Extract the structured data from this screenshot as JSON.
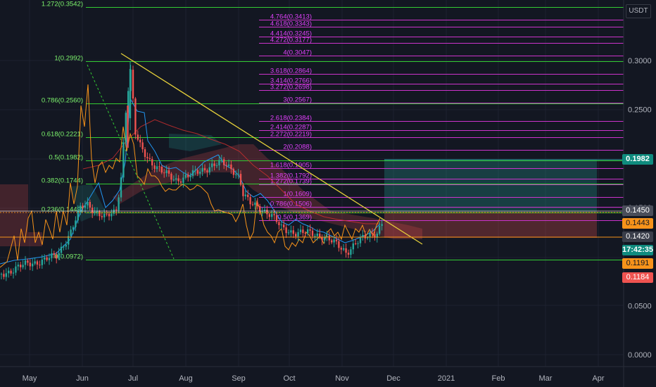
{
  "chart_data": {
    "type": "candlestick",
    "symbol_currency": "USDT",
    "xaxis": {
      "months": [
        "May",
        "Jun",
        "Jul",
        "Aug",
        "Sep",
        "Oct",
        "Nov",
        "Dec",
        "2021",
        "Feb",
        "Mar",
        "Apr"
      ]
    },
    "yaxis": {
      "ticks": [
        "0.3000",
        "0.2500",
        "0.1500",
        "0.0500",
        "0.0000"
      ],
      "scale": "linear"
    },
    "price_tags": [
      {
        "value": "0.1982",
        "color": "#0f8b7e"
      },
      {
        "value": "0.1450",
        "color": "#4a4e5a"
      },
      {
        "value": "0.1443",
        "color": "#f7931a"
      },
      {
        "value": "0.1420",
        "color": "#3a3e4a"
      },
      {
        "value": "17:42:35",
        "color": "#0f8b7e"
      },
      {
        "value": "0.1191",
        "color": "#f7931a"
      },
      {
        "value": "0.1184",
        "color": "#ef5350"
      }
    ],
    "fib_retracement": [
      {
        "level": "1.272(0.3542)",
        "price": 0.3542
      },
      {
        "level": "1(0.2992)",
        "price": 0.2992
      },
      {
        "level": "0.786(0.2560)",
        "price": 0.256
      },
      {
        "level": "0.618(0.2221)",
        "price": 0.2221
      },
      {
        "level": "0.5(0.1982)",
        "price": 0.1982
      },
      {
        "level": "0.382(0.1744)",
        "price": 0.1744
      },
      {
        "level": "0.236(0.1449)",
        "price": 0.1449
      },
      {
        "level": "0(0.0972)",
        "price": 0.0972
      }
    ],
    "fib_extension": [
      {
        "level": "4.764(0.3413)",
        "price": 0.3413
      },
      {
        "level": "4.618(0.3343)",
        "price": 0.3343
      },
      {
        "level": "4.414(0.3245)",
        "price": 0.3245
      },
      {
        "level": "4.272(0.3177)",
        "price": 0.3177
      },
      {
        "level": "4(0.3047)",
        "price": 0.3047
      },
      {
        "level": "3.618(0.2864)",
        "price": 0.2864
      },
      {
        "level": "3.414(0.2766)",
        "price": 0.2766
      },
      {
        "level": "3.272(0.2698)",
        "price": 0.2698
      },
      {
        "level": "3(0.2567)",
        "price": 0.2567
      },
      {
        "level": "2.618(0.2384)",
        "price": 0.2384
      },
      {
        "level": "2.414(0.2287)",
        "price": 0.2287
      },
      {
        "level": "2.272(0.2219)",
        "price": 0.2219
      },
      {
        "level": "2(0.2088)",
        "price": 0.2088
      },
      {
        "level": "1.618(0.1905)",
        "price": 0.1905
      },
      {
        "level": "1.382(0.1792)",
        "price": 0.1792
      },
      {
        "level": "1.272(0.1739)",
        "price": 0.1739
      },
      {
        "level": "1(0.1609)",
        "price": 0.1609
      },
      {
        "level": "0.786(0.1506)",
        "price": 0.1506
      },
      {
        "level": "0.5(0.1369)",
        "price": 0.1369
      }
    ],
    "colors": {
      "background": "#131722",
      "retracement": "#33cc33",
      "extension": "#cc33cc",
      "trendline": "#e6d13a",
      "up_candle": "#26a69a",
      "down_candle": "#ef5350",
      "line_orange": "#f7931a",
      "line_blue": "#2196f3",
      "line_red": "#d32f2f"
    }
  }
}
